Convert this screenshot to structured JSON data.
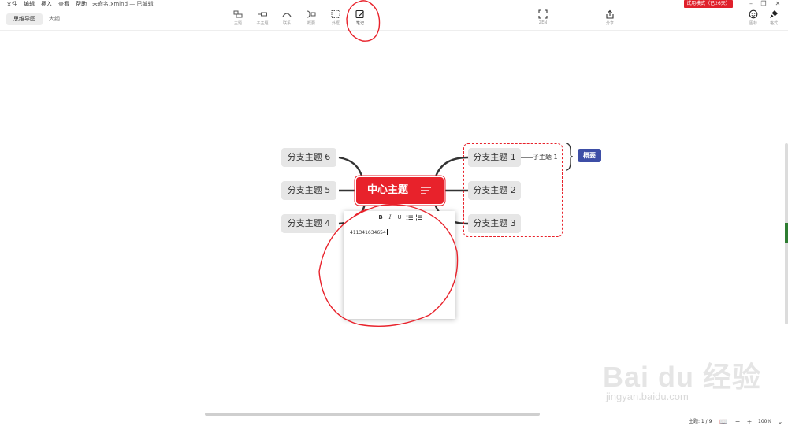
{
  "menu": {
    "file": "文件",
    "edit": "编辑",
    "insert": "插入",
    "view": "查看",
    "help": "帮助"
  },
  "file_title": "未命名.xmind — 已编辑",
  "trial_badge": "试用模式（已26天）",
  "view_tabs": {
    "mindmap": "思维导图",
    "outline": "大纲"
  },
  "toolbar": {
    "topic": "主题",
    "subtopic": "子主题",
    "relationship": "联系",
    "summary": "概要",
    "boundary": "外框",
    "note": "笔记",
    "zen": "ZEN",
    "share": "分享",
    "icon": "图标",
    "format": "格式"
  },
  "mindmap": {
    "central": "中心主题",
    "left_branches": [
      "分支主题 6",
      "分支主题 5",
      "分支主题 4"
    ],
    "right_branches": [
      "分支主题 1",
      "分支主题 2",
      "分支主题 3"
    ],
    "subtopic": "子主题 1",
    "summary": "概要"
  },
  "note": {
    "toolbar": {
      "bold": "B",
      "italic": "I",
      "underline": "U"
    },
    "text": "411341634654"
  },
  "status": {
    "topic_count": "主题: 1 / 9",
    "zoom": "100%"
  },
  "watermark": {
    "brand": "Bai du 经验",
    "url": "jingyan.baidu.com"
  },
  "colors": {
    "central": "#e8222b",
    "branch_bg": "#e6e6e6",
    "summary_tag": "#3d4ea6",
    "trial_badge": "#e0202b",
    "annotation": "#e8222b"
  },
  "icons": {
    "topic": "topic-icon",
    "subtopic": "subtopic-icon",
    "relationship": "relationship-icon",
    "summary": "summary-bracket-icon",
    "boundary": "boundary-icon",
    "note": "note-edit-icon",
    "zen": "fullscreen-icon",
    "share": "share-icon",
    "icon": "emoji-icon",
    "format": "brush-icon"
  }
}
